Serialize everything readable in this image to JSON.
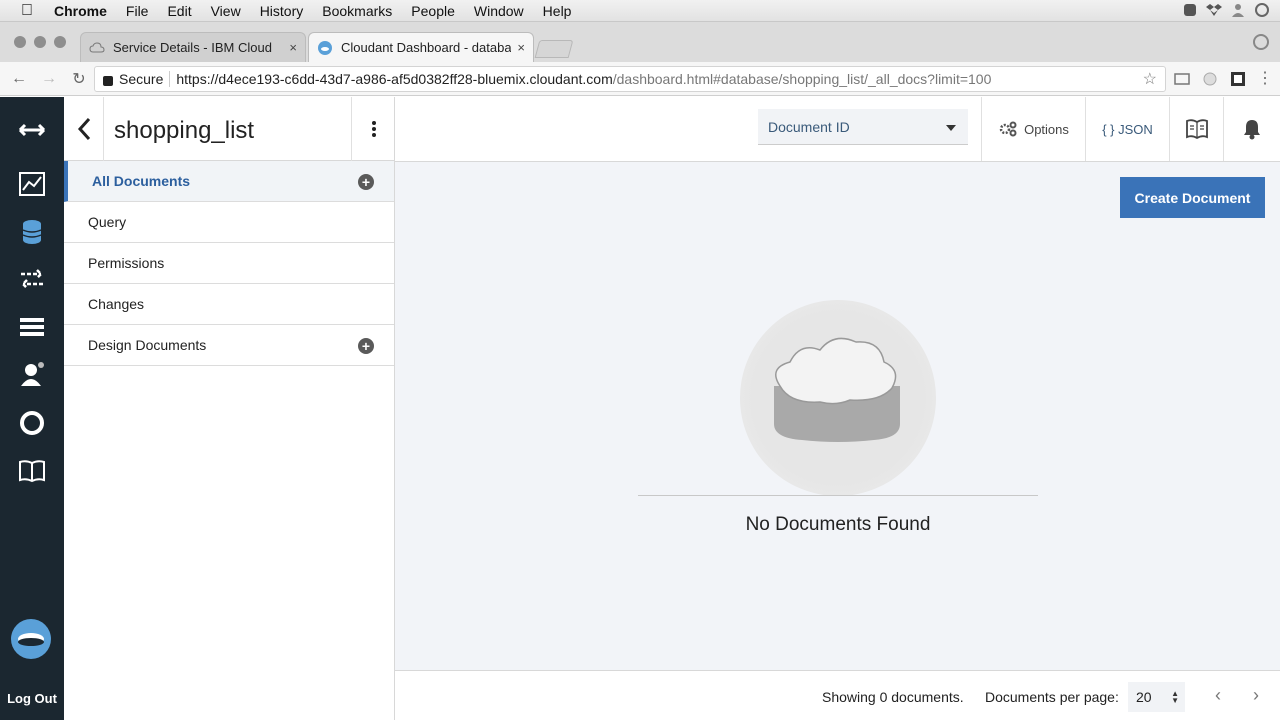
{
  "menubar": {
    "items": [
      "Chrome",
      "File",
      "Edit",
      "View",
      "History",
      "Bookmarks",
      "People",
      "Window",
      "Help"
    ]
  },
  "browser": {
    "tabs": [
      {
        "label": "Service Details - IBM Cloud",
        "close": "×"
      },
      {
        "label": "Cloudant Dashboard - databas",
        "close": "×"
      }
    ],
    "secure_label": "Secure",
    "url_host": "https://d4ece193-c6dd-43d7-a986-af5d0382ff28-bluemix.cloudant.com",
    "url_path": "/dashboard.html#database/shopping_list/_all_docs?limit=100"
  },
  "leftnav": {
    "icons": [
      "databases-arrows-icon",
      "monitoring-icon",
      "databases-icon",
      "replication-icon",
      "active-tasks-icon",
      "account-icon",
      "support-icon",
      "documentation-icon"
    ],
    "logout_label": "Log Out"
  },
  "database": {
    "name": "shopping_list"
  },
  "sidebar": {
    "items": [
      {
        "label": "All Documents",
        "active": true,
        "add": true
      },
      {
        "label": "Query",
        "active": false,
        "add": false
      },
      {
        "label": "Permissions",
        "active": false,
        "add": false
      },
      {
        "label": "Changes",
        "active": false,
        "add": false
      },
      {
        "label": "Design Documents",
        "active": false,
        "add": true
      }
    ]
  },
  "toolbar": {
    "doc_select_value": "Document ID",
    "options_label": "Options",
    "json_label": "{ } JSON"
  },
  "main": {
    "create_button_label": "Create Document",
    "empty_message": "No Documents Found"
  },
  "footer": {
    "showing_text": "Showing 0 documents.",
    "per_page_label": "Documents per page:",
    "per_page_value": "20"
  },
  "colors": {
    "accent": "#3a73b8",
    "leftnav_bg": "#1b2730",
    "content_bg": "#f2f4f8"
  }
}
